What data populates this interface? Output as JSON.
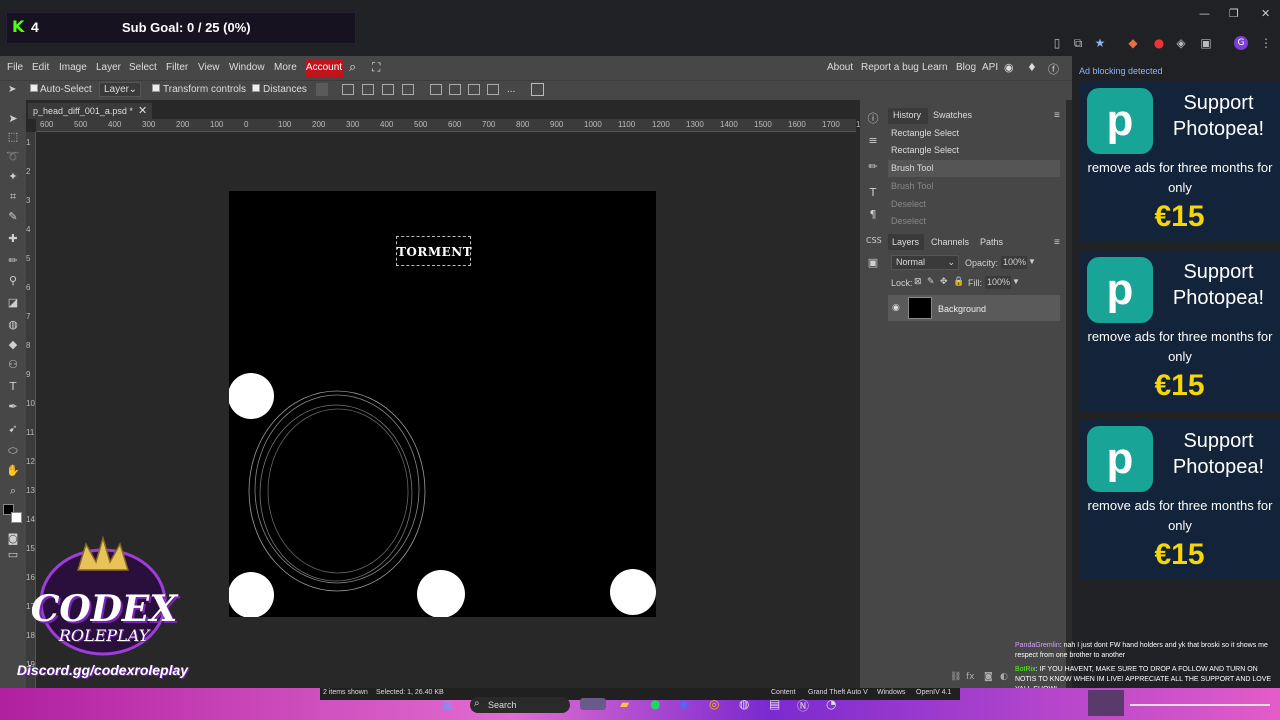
{
  "stream": {
    "count": "4",
    "sub_goal": "Sub Goal: 0 / 25 (0%)",
    "logo_title": "CODEX",
    "logo_sub": "ROLEPLAY",
    "logo_url": "Discord.gg/codexroleplay"
  },
  "menu": [
    "File",
    "Edit",
    "Image",
    "Layer",
    "Select",
    "Filter",
    "View",
    "Window",
    "More"
  ],
  "account_label": "Account",
  "right_links": [
    "About",
    "Report a bug",
    "Learn",
    "Blog",
    "API"
  ],
  "options": {
    "auto_select": "Auto-Select",
    "layer_value": "Layer",
    "transform_controls": "Transform controls",
    "distances": "Distances"
  },
  "document": {
    "tab": "p_head_diff_001_a.psd *",
    "canvas_text": "TORMENT"
  },
  "ruler_h": [
    "600",
    "500",
    "400",
    "300",
    "200",
    "100",
    "0",
    "100",
    "200",
    "300",
    "400",
    "500",
    "600",
    "700",
    "800",
    "900",
    "1000",
    "1100",
    "1200",
    "1300",
    "1400",
    "1500",
    "1600",
    "1700",
    "1800"
  ],
  "ruler_v": [
    "1",
    "2",
    "3",
    "4",
    "5",
    "6",
    "7",
    "8",
    "9",
    "10",
    "11",
    "12",
    "13",
    "14",
    "15",
    "16",
    "17",
    "18",
    "19"
  ],
  "history": {
    "tab": "History",
    "swatches_tab": "Swatches",
    "items": [
      "Rectangle Select",
      "Rectangle Select",
      "Brush Tool",
      "Brush Tool",
      "Deselect",
      "Deselect"
    ]
  },
  "layers": {
    "tabs": [
      "Layers",
      "Channels",
      "Paths"
    ],
    "blend_mode": "Normal",
    "opacity_label": "Opacity:",
    "opacity_value": "100%",
    "lock_label": "Lock:",
    "fill_label": "Fill:",
    "fill_value": "100%",
    "layer_name": "Background"
  },
  "ads": {
    "blocking": "Ad blocking detected",
    "title": "Support Photopea!",
    "text": "remove ads for three months for only",
    "price": "€15"
  },
  "chat": [
    {
      "user": "PandaGremlin",
      "text": ": nah I just dont FW hand holders and yk that broski so it shows me respect from one brother to another"
    },
    {
      "user": "BotRix",
      "text": ": IF YOU HAVENT, MAKE SURE TO DROP A FOLLOW AND TURN ON NOTIS TO KNOW WHEN IM LIVE! APPRECIATE ALL THE SUPPORT AND LOVE YALL SHOW!"
    }
  ],
  "status": {
    "items_shown": "2 items shown",
    "selected": "Selected: 1,  26.40 KB",
    "content": "Content",
    "gta": "Grand Theft Auto V",
    "windows": "Windows",
    "openiv": "OpenIV 4.1"
  },
  "taskbar": {
    "search": "Search"
  },
  "colors": {
    "accent_account": "#c0141c",
    "ad_price": "#f5d60b",
    "ad_logo": "#18a497",
    "kick_green": "#53fc18"
  }
}
